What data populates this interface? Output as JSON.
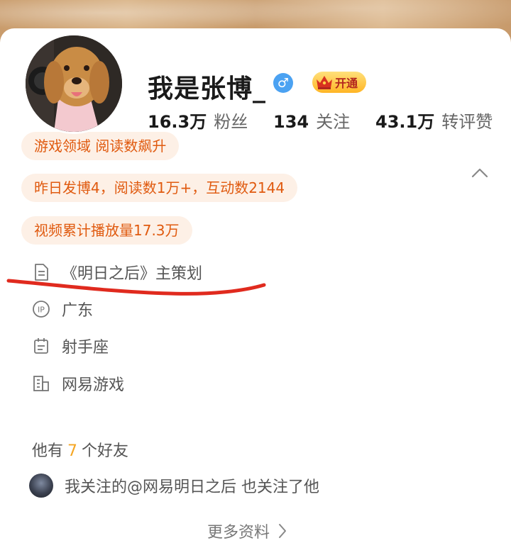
{
  "profile": {
    "name": "我是张博_",
    "gender_icon": "male-symbol-icon",
    "gender_glyph": "♂",
    "vip_label": "开通"
  },
  "stats": [
    {
      "value": "16.3万",
      "label": "粉丝"
    },
    {
      "value": "134",
      "label": "关注"
    },
    {
      "value": "43.1万",
      "label": "转评赞"
    }
  ],
  "tags": [
    "游戏领域 阅读数飙升",
    "昨日发博4，阅读数1万+，互动数2144",
    "视频累计播放量17.3万"
  ],
  "info": {
    "bio": "《明日之后》主策划",
    "ip": "广东",
    "zodiac": "射手座",
    "company": "网易游戏"
  },
  "friends": {
    "prefix": "他有",
    "count": "7",
    "suffix": "个好友"
  },
  "mutual_follow": "我关注的@网易明日之后 也关注了他",
  "more_link": "更多资料",
  "colors": {
    "tag_bg": "#fdf0e6",
    "tag_text": "#e05a0f",
    "gender_badge": "#4ba2f2",
    "vip_gold": "#ffb525",
    "friend_count": "#f5a623",
    "annotation_red": "#e02a1e"
  }
}
